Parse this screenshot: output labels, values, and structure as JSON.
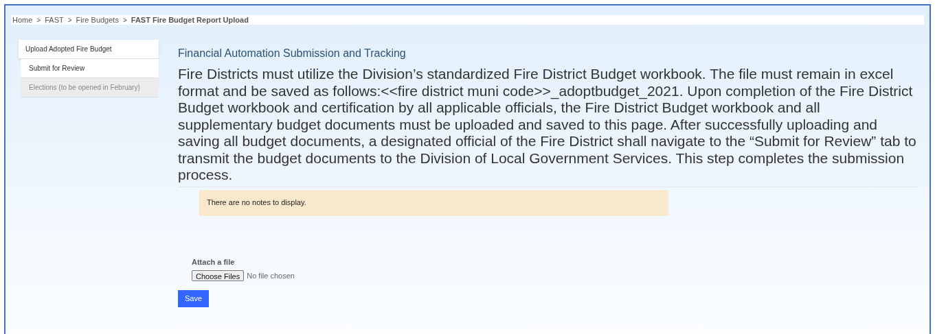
{
  "breadcrumb": [
    {
      "label": "Home",
      "current": false
    },
    {
      "label": "FAST",
      "current": false
    },
    {
      "label": "Fire Budgets",
      "current": false
    },
    {
      "label": "FAST Fire Budget Report Upload",
      "current": true
    }
  ],
  "breadcrumb_separator": ">",
  "sidebar": {
    "items": [
      {
        "label": "Upload Adopted Fire Budget",
        "selected": true,
        "disabled": false
      },
      {
        "label": "Submit for Review",
        "selected": false,
        "disabled": false
      },
      {
        "label": "Elections (to be opened in February)",
        "selected": false,
        "disabled": true
      }
    ]
  },
  "heading": "Financial Automation Submission and Tracking",
  "instructions": "Fire Districts must utilize the Division’s standardized Fire District Budget workbook. The file must remain in excel format and be saved as follows:<<fire district muni code>>_adoptbudget_2021. Upon completion of the Fire District Budget workbook and certification by all applicable officials, the Fire District Budget workbook and all supplementary budget documents must be uploaded and saved to this page. After successfully uploading and saving all budget documents, a designated official of the Fire District shall navigate to the “Submit for Review” tab to transmit the budget documents to the Division of Local Government Services. This step completes the submission process.",
  "notes": "There are no notes to display.",
  "attach": {
    "label": "Attach a file",
    "button": "Choose Files",
    "status": "No file chosen"
  },
  "save_button": "Save"
}
